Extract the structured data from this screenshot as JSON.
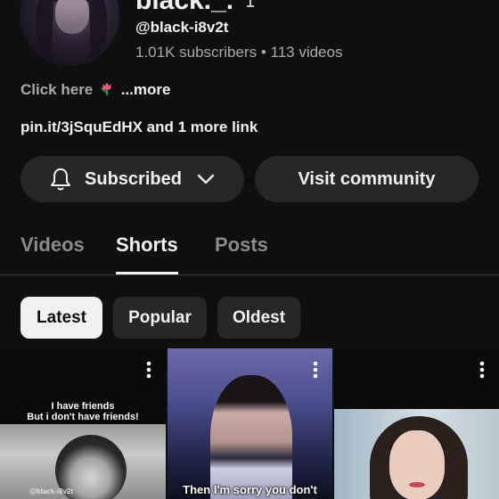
{
  "channel": {
    "name": "black._.",
    "name_suffix_icon": "martini-glass-icon",
    "handle": "@black-i8v2t",
    "subscribers": "1.01K subscribers",
    "separator": "•",
    "videos": "113 videos"
  },
  "description": {
    "text": "Click here",
    "emoji": "tulip",
    "more": "...more"
  },
  "links": {
    "text": "pin.it/3jSquEdHX and 1 more link"
  },
  "actions": {
    "subscribed_label": "Subscribed",
    "community_label": "Visit community"
  },
  "tabs": [
    {
      "label": "Videos",
      "active": false
    },
    {
      "label": "Shorts",
      "active": true
    },
    {
      "label": "Posts",
      "active": false
    }
  ],
  "filters": [
    {
      "label": "Latest",
      "selected": true
    },
    {
      "label": "Popular",
      "selected": false
    },
    {
      "label": "Oldest",
      "selected": false
    }
  ],
  "shorts": [
    {
      "caption_line1": "I have friends",
      "caption_line2": "But i don't have friends!",
      "watermark": "@black-i8v2t"
    },
    {
      "caption": "Then I'm sorry you don't"
    },
    {
      "caption": ""
    }
  ],
  "colors": {
    "background": "#0f0f0f",
    "surface": "#272727",
    "text_primary": "#f1f1f1",
    "text_secondary": "#aaaaaa",
    "chip_selected_bg": "#f1f1f1"
  }
}
